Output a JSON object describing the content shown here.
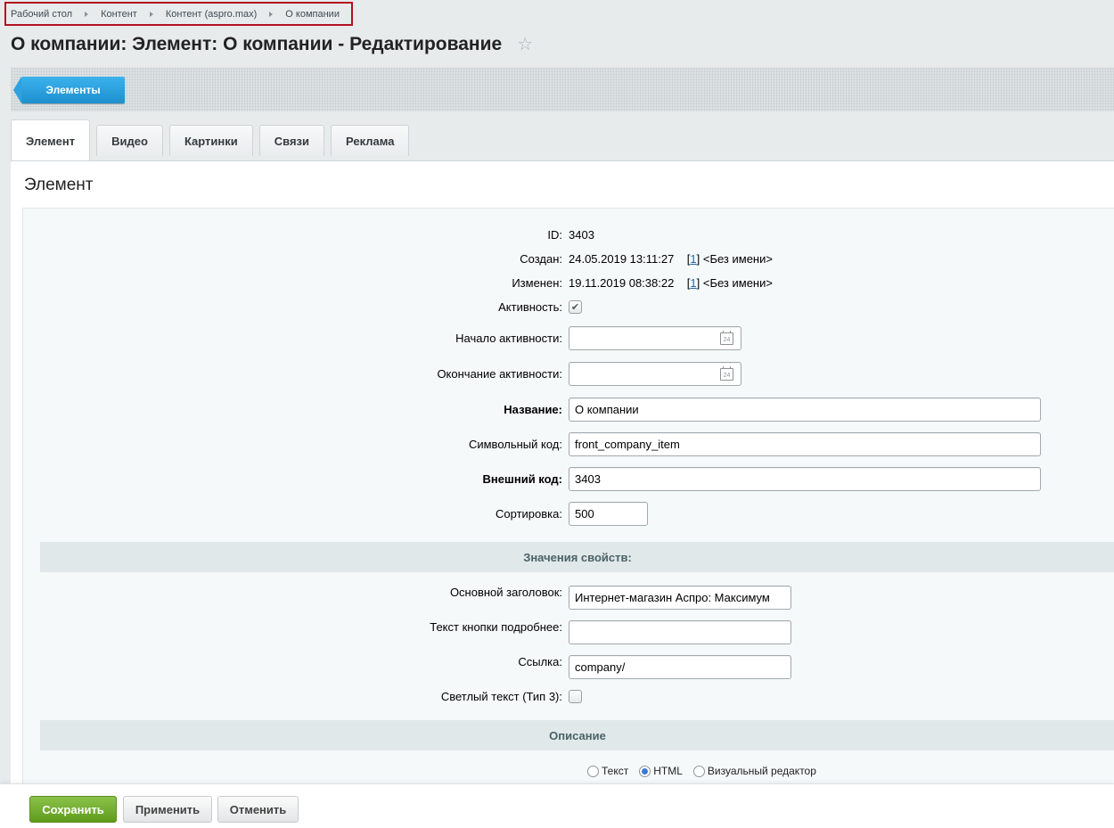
{
  "breadcrumb": [
    "Рабочий стол",
    "Контент",
    "Контент (aspro.max)",
    "О компании"
  ],
  "page_title": "О компании: Элемент: О компании - Редактирование",
  "toolbar": {
    "elements_button": "Элементы"
  },
  "tabs": [
    "Элемент",
    "Видео",
    "Картинки",
    "Связи",
    "Реклама"
  ],
  "panel_title": "Элемент",
  "fields": {
    "id_label": "ID:",
    "id_value": "3403",
    "created_label": "Создан:",
    "created_value": "24.05.2019 13:11:27",
    "created_user_link": "1",
    "created_user_name": "<Без имени>",
    "modified_label": "Изменен:",
    "modified_value": "19.11.2019 08:38:22",
    "modified_user_link": "1",
    "modified_user_name": "<Без имени>",
    "active_label": "Активность:",
    "active_from_label": "Начало активности:",
    "active_from_value": "",
    "active_to_label": "Окончание активности:",
    "active_to_value": "",
    "name_label": "Название:",
    "name_value": "О компании",
    "code_label": "Символьный код:",
    "code_value": "front_company_item",
    "xml_id_label": "Внешний код:",
    "xml_id_value": "3403",
    "sort_label": "Сортировка:",
    "sort_value": "500"
  },
  "properties": {
    "section_title": "Значения свойств:",
    "main_title_label": "Основной заголовок:",
    "main_title_value": "Интернет-магазин Аспро: Максимум",
    "more_button_label": "Текст кнопки подробнее:",
    "more_button_value": "",
    "link_label": "Ссылка:",
    "link_value": "company/",
    "light_text_label": "Светлый текст (Тип 3):"
  },
  "description": {
    "section_title": "Описание",
    "radio_text": "Текст",
    "radio_html": "HTML",
    "radio_visual": "Визуальный редактор",
    "selected": "HTML"
  },
  "calendar_icon_text": "24",
  "footer": {
    "save": "Сохранить",
    "apply": "Применить",
    "cancel": "Отменить"
  },
  "colors": {
    "accent_blue": "#1e8fd0",
    "save_green": "#5f9b1c",
    "highlight_red": "#b3111e"
  }
}
